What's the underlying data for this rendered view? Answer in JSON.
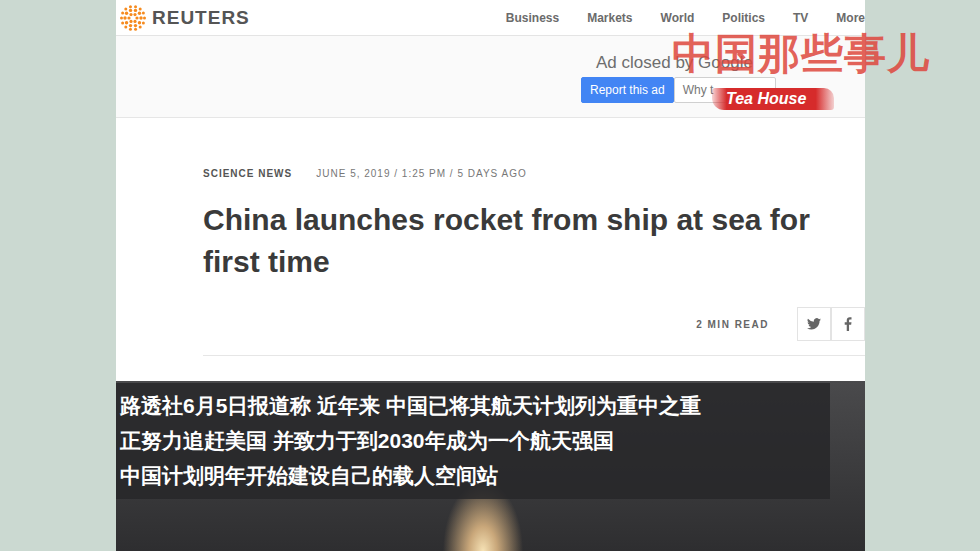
{
  "logo": {
    "text": "REUTERS"
  },
  "nav": [
    "Business",
    "Markets",
    "World",
    "Politics",
    "TV",
    "More"
  ],
  "ad": {
    "notice": "Ad closed by Google",
    "buttons": [
      {
        "label": "Report this ad",
        "primary": true
      },
      {
        "label": "Why t",
        "primary": false
      }
    ]
  },
  "article": {
    "section": "SCIENCE NEWS",
    "date": "JUNE 5, 2019 / 1:25 PM / 5 DAYS AGO",
    "headline": "China launches rocket from ship at sea for first time",
    "read_time": "2 MIN READ"
  },
  "subtitles": [
    "路透社6月5日报道称 近年来 中国已将其航天计划列为重中之重",
    "正努力追赶美国 并致力于到2030年成为一个航天强国",
    "中国计划明年开始建设自己的载人空间站"
  ],
  "watermark": {
    "title": "中国那些事儿",
    "badge": "Tea House"
  }
}
